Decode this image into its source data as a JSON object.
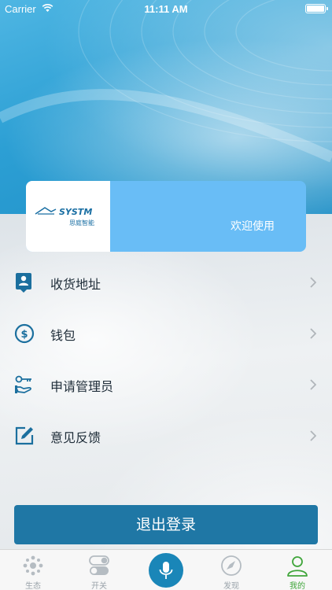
{
  "status_bar": {
    "carrier": "Carrier",
    "time": "11:11 AM"
  },
  "profile": {
    "logo_text": "SYSTM",
    "logo_subtitle": "思庭智能",
    "welcome": "欢迎使用"
  },
  "menu": {
    "items": [
      {
        "label": "收货地址",
        "icon": "address-book-icon"
      },
      {
        "label": "钱包",
        "icon": "wallet-dollar-icon"
      },
      {
        "label": "申请管理员",
        "icon": "key-hand-icon"
      },
      {
        "label": "意见反馈",
        "icon": "edit-feedback-icon"
      }
    ]
  },
  "logout_label": "退出登录",
  "tab_bar": {
    "tabs": [
      {
        "label": "生态",
        "icon": "ecosystem-icon",
        "active": false
      },
      {
        "label": "开关",
        "icon": "toggle-switch-icon",
        "active": false
      },
      {
        "label": "",
        "icon": "microphone-icon",
        "active": false
      },
      {
        "label": "发现",
        "icon": "compass-icon",
        "active": false
      },
      {
        "label": "我的",
        "icon": "user-icon",
        "active": true
      }
    ]
  },
  "colors": {
    "accent": "#1f77a5",
    "card": "#69bdf6",
    "active_tab": "#3fa53a",
    "icon": "#1b6f9e"
  }
}
